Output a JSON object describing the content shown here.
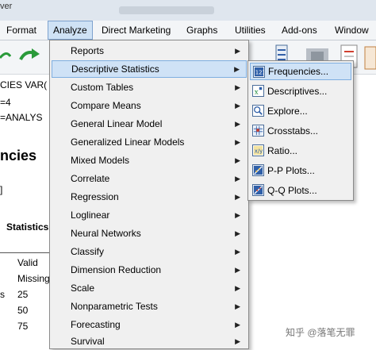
{
  "window": {
    "title_fragment": "ver"
  },
  "menubar": [
    {
      "label": "Format"
    },
    {
      "label": "Analyze"
    },
    {
      "label": "Direct Marketing"
    },
    {
      "label": "Graphs"
    },
    {
      "label": "Utilities"
    },
    {
      "label": "Add-ons"
    },
    {
      "label": "Window"
    }
  ],
  "output": {
    "line1": "CIES VAR(",
    "line2": "=4",
    "line3": "=ANALYS",
    "heading": "ncies",
    "bracket": "]",
    "statistics_title": "Statistics",
    "rows": [
      {
        "label": "Valid",
        "value": ""
      },
      {
        "label": "Missing",
        "value": ""
      },
      {
        "label": "",
        "value": "25"
      },
      {
        "label": "",
        "value": "50"
      },
      {
        "label": "",
        "value": "75"
      }
    ],
    "marker": "s"
  },
  "analyze_menu": [
    {
      "label": "Reports",
      "highlighted": false
    },
    {
      "label": "Descriptive Statistics",
      "highlighted": true
    },
    {
      "label": "Custom Tables",
      "highlighted": false
    },
    {
      "label": "Compare Means",
      "highlighted": false
    },
    {
      "label": "General Linear Model",
      "highlighted": false
    },
    {
      "label": "Generalized Linear Models",
      "highlighted": false
    },
    {
      "label": "Mixed Models",
      "highlighted": false
    },
    {
      "label": "Correlate",
      "highlighted": false
    },
    {
      "label": "Regression",
      "highlighted": false
    },
    {
      "label": "Loglinear",
      "highlighted": false
    },
    {
      "label": "Neural Networks",
      "highlighted": false
    },
    {
      "label": "Classify",
      "highlighted": false
    },
    {
      "label": "Dimension Reduction",
      "highlighted": false
    },
    {
      "label": "Scale",
      "highlighted": false
    },
    {
      "label": "Nonparametric Tests",
      "highlighted": false
    },
    {
      "label": "Forecasting",
      "highlighted": false
    },
    {
      "label": "Survival",
      "highlighted": false
    }
  ],
  "descriptive_submenu": [
    {
      "label": "Frequencies...",
      "icon": "frequencies-icon",
      "highlighted": true
    },
    {
      "label": "Descriptives...",
      "icon": "descriptives-icon",
      "highlighted": false
    },
    {
      "label": "Explore...",
      "icon": "explore-icon",
      "highlighted": false
    },
    {
      "label": "Crosstabs...",
      "icon": "crosstabs-icon",
      "highlighted": false
    },
    {
      "label": "Ratio...",
      "icon": "ratio-icon",
      "highlighted": false
    },
    {
      "label": "P-P Plots...",
      "icon": "pp-plots-icon",
      "highlighted": false
    },
    {
      "label": "Q-Q Plots...",
      "icon": "qq-plots-icon",
      "highlighted": false
    }
  ],
  "watermark": "知乎 @落笔无罪",
  "colors": {
    "highlight_bg": "#cfe2f6",
    "highlight_border": "#7eaee0",
    "menu_bg": "#f0f0f0"
  }
}
